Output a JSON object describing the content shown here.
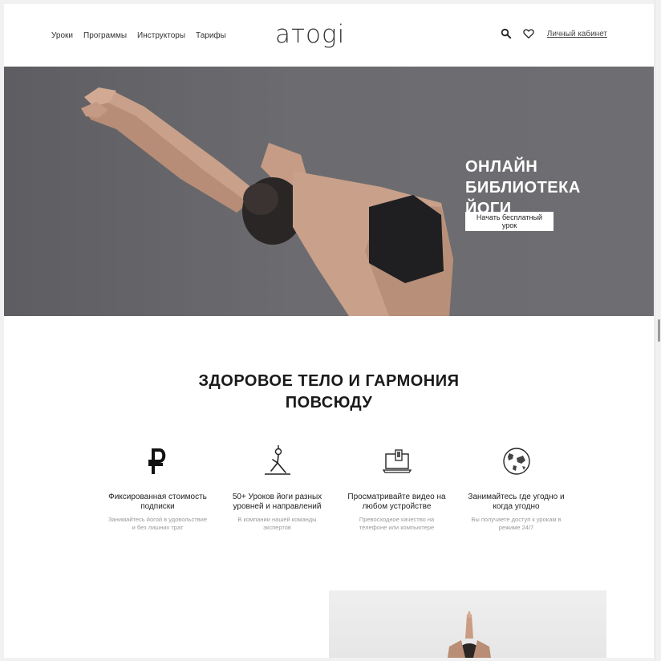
{
  "header": {
    "nav": [
      "Уроки",
      "Программы",
      "Инструкторы",
      "Тарифы"
    ],
    "logo": "aтogi",
    "cabinet_label": "Личный кабинет",
    "icons": [
      "search-icon",
      "heart-icon"
    ]
  },
  "hero": {
    "title_line1": "ОНЛАЙН БИБЛИОТЕКА",
    "title_line2": "ЙОГИ",
    "button_label": "Начать бесплатный урок"
  },
  "section": {
    "title_line1": "ЗДОРОВОЕ ТЕЛО И ГАРМОНИЯ",
    "title_line2": "ПОВСЮДУ"
  },
  "features": [
    {
      "icon": "ruble-icon",
      "title": "Фиксированная стоимость подписки",
      "desc": "Занимайтесь йогой в удовольствие и без лишних трат"
    },
    {
      "icon": "yoga-pose-icon",
      "title": "50+ Уроков йоги разных уровней и направлений",
      "desc": "В компании нашей команды экспертов"
    },
    {
      "icon": "devices-icon",
      "title": "Просматривайте видео на любом устройстве",
      "desc": "Превосходное качество на телефоне или компьютере"
    },
    {
      "icon": "globe-icon",
      "title": "Занимайтесь где угодно и когда угодно",
      "desc": "Вы получаете доступ к урокам в режиме 24/7"
    }
  ],
  "colors": {
    "hero_bg": "#6c6c70",
    "text": "#1a1a1a",
    "muted": "#9a9a9a"
  }
}
